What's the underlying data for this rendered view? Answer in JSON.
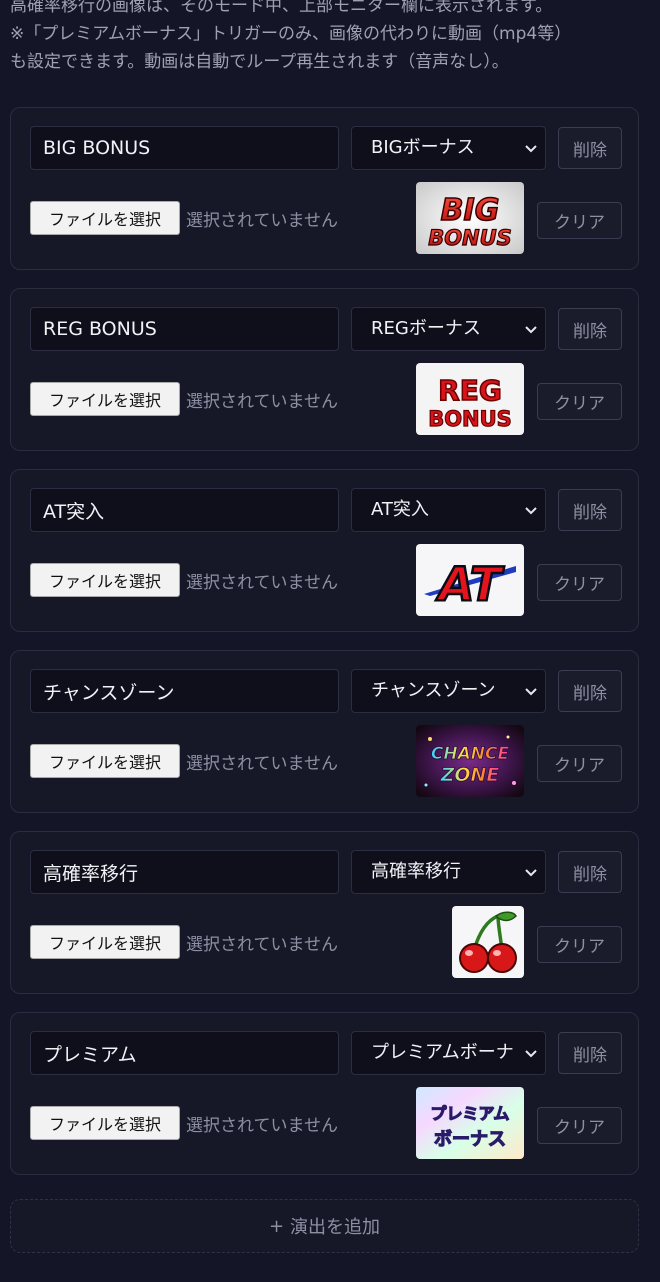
{
  "intro": {
    "line1": "高確率移行の画像は、そのモード中、上部モニター欄に表示されます。",
    "line2": "※「プレミアムボーナス」トリガーのみ、画像の代わりに動画（mp4等）",
    "line3": "も設定できます。動画は自動でループ再生されます（音声なし）。"
  },
  "cards": [
    {
      "name": "BIG BONUS",
      "type": "BIGボーナス",
      "delete": "削除",
      "file_button": "ファイルを選択",
      "file_status": "選択されていません",
      "clear": "クリア",
      "thumb_text": "BIG BONUS"
    },
    {
      "name": "REG BONUS",
      "type": "REGボーナス",
      "delete": "削除",
      "file_button": "ファイルを選択",
      "file_status": "選択されていません",
      "clear": "クリア",
      "thumb_text": "REG BONUS"
    },
    {
      "name": "AT突入",
      "type": "AT突入",
      "delete": "削除",
      "file_button": "ファイルを選択",
      "file_status": "選択されていません",
      "clear": "クリア",
      "thumb_text": "AT"
    },
    {
      "name": "チャンスゾーン",
      "type": "チャンスゾーン",
      "delete": "削除",
      "file_button": "ファイルを選択",
      "file_status": "選択されていません",
      "clear": "クリア",
      "thumb_text": "CHANCE ZONE"
    },
    {
      "name": "高確率移行",
      "type": "高確率移行",
      "delete": "削除",
      "file_button": "ファイルを選択",
      "file_status": "選択されていません",
      "clear": "クリア",
      "thumb_text": ""
    },
    {
      "name": "プレミアム",
      "type": "プレミアムボーナス",
      "delete": "削除",
      "file_button": "ファイルを選択",
      "file_status": "選択されていません",
      "clear": "クリア",
      "thumb_text": "プレミアム ボーナス"
    }
  ],
  "add_button": {
    "icon": "+",
    "label": "演出を追加"
  },
  "icons": {
    "select": "chevron-down-icon",
    "add": "plus-icon"
  }
}
